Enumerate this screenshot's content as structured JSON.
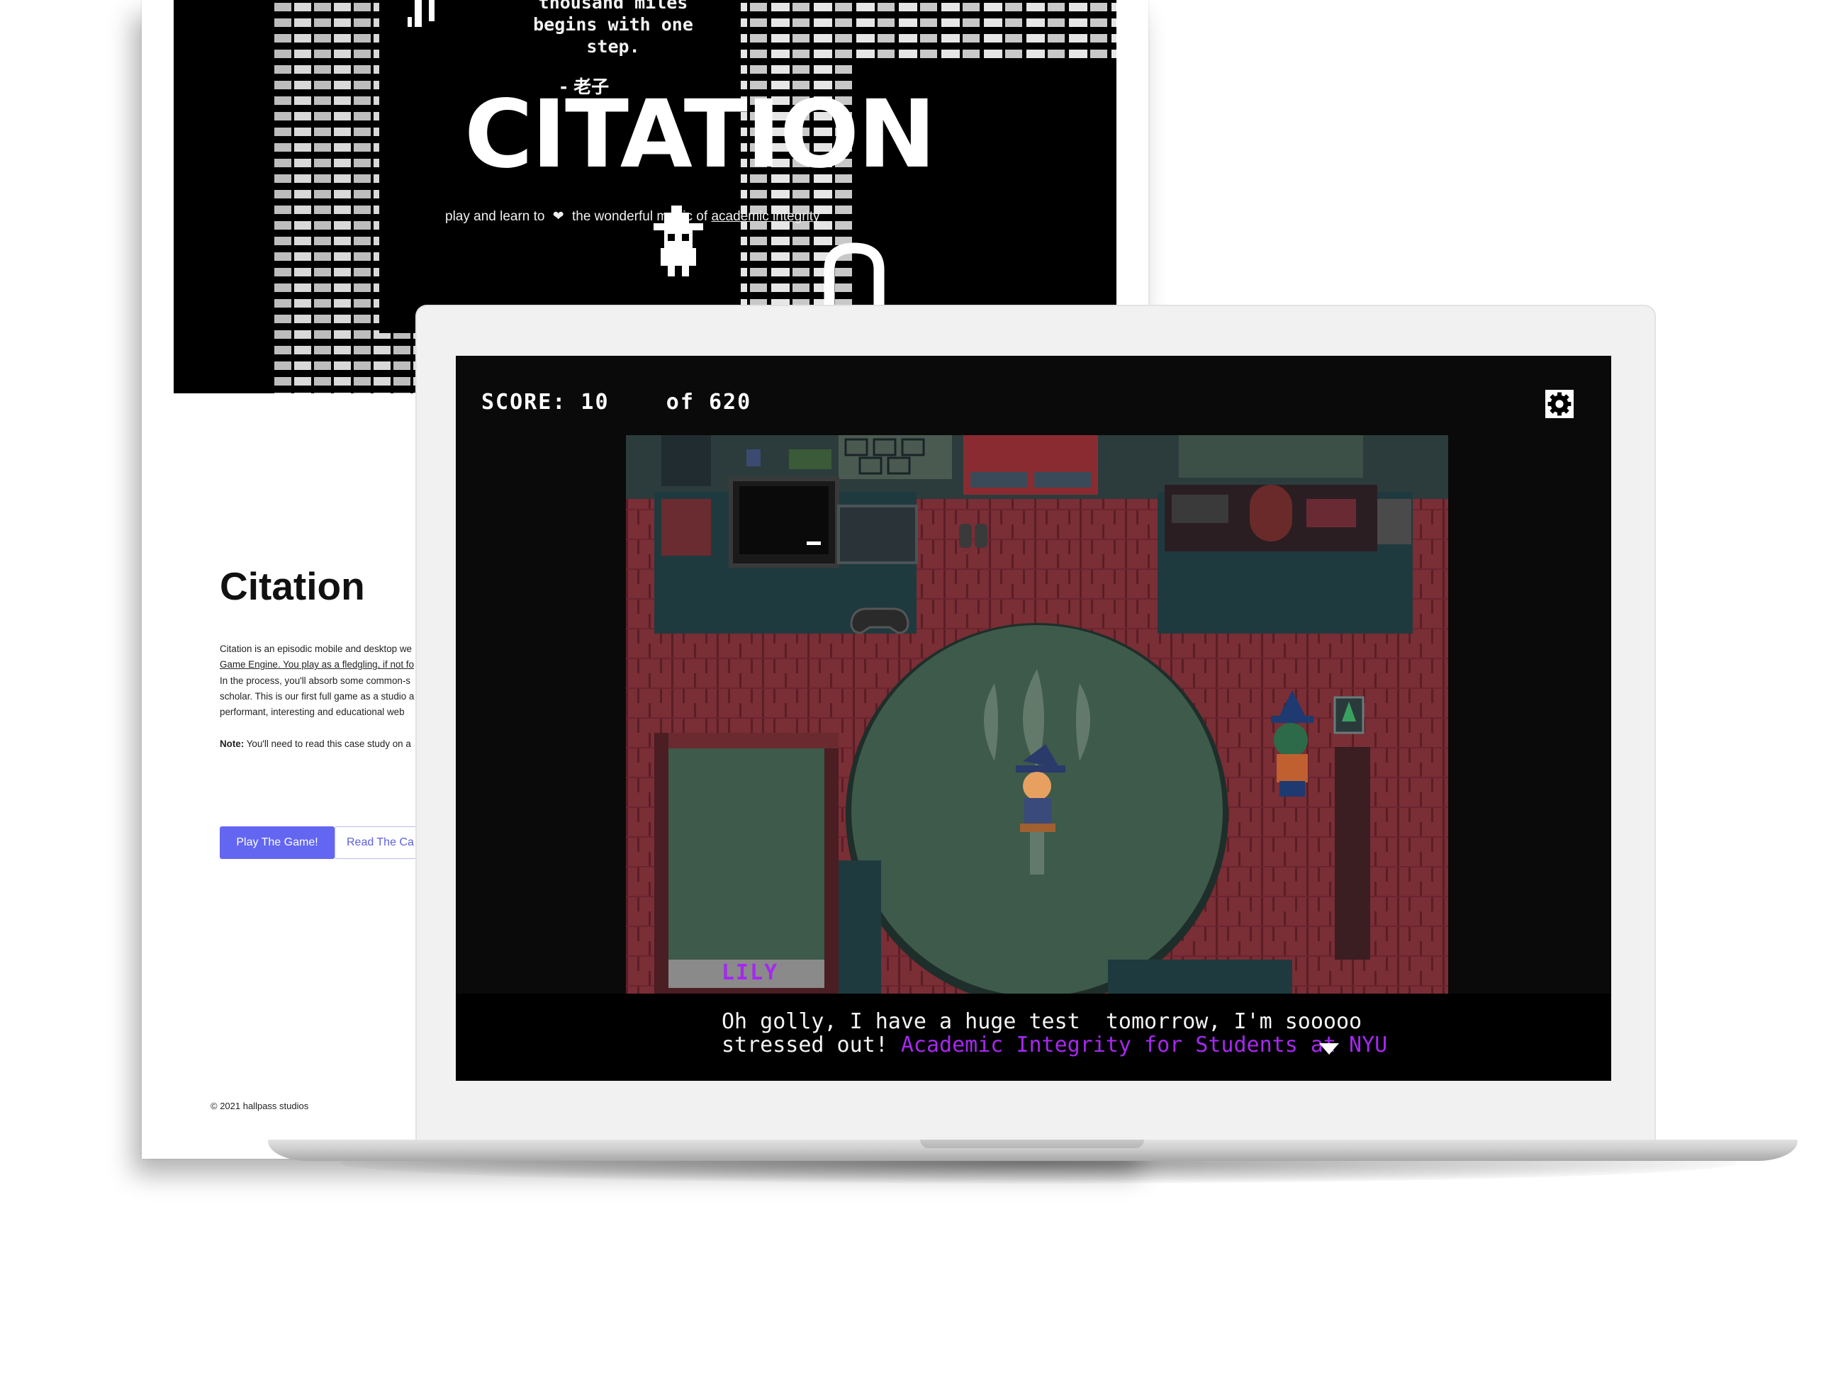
{
  "site": {
    "hero": {
      "quote": "thousand miles\nbegins with one\nstep.",
      "quote_author": "- 老子",
      "title": "CITATION",
      "tagline_before": "play and learn to",
      "tagline_middle": "the wonderful magic of",
      "tagline_link": "academic integrity",
      "heart_icon": "heart-icon"
    },
    "case_study": {
      "title": "Citation",
      "body_lines": [
        "Citation is an episodic mobile and desktop we",
        "Game Engine. You play as a fledgling, if not fo",
        "In the process, you'll absorb some common-s",
        "scholar. This is our first full game as a studio a",
        "performant, interesting and educational web"
      ],
      "note_label": "Note:",
      "note_text": "You'll need to read this case study on a",
      "play_button": "Play The Game!",
      "read_button": "Read The Ca"
    },
    "footer": "© 2021 hallpass studios"
  },
  "game": {
    "score_label": "SCORE: 10    of 620",
    "settings_icon": "gear-icon",
    "nameplate": "LILY",
    "dialog_line1": "Oh golly, I have a huge test  tomorrow, I'm sooooo",
    "dialog_line2_prefix": "stressed out! ",
    "dialog_link": "Academic Integrity for Students at NYU",
    "colors": {
      "link_purple": "#a628f0",
      "button_indigo": "#6366f1",
      "floor_red": "#7a2e35",
      "rug_green": "#3d5a4a"
    }
  }
}
